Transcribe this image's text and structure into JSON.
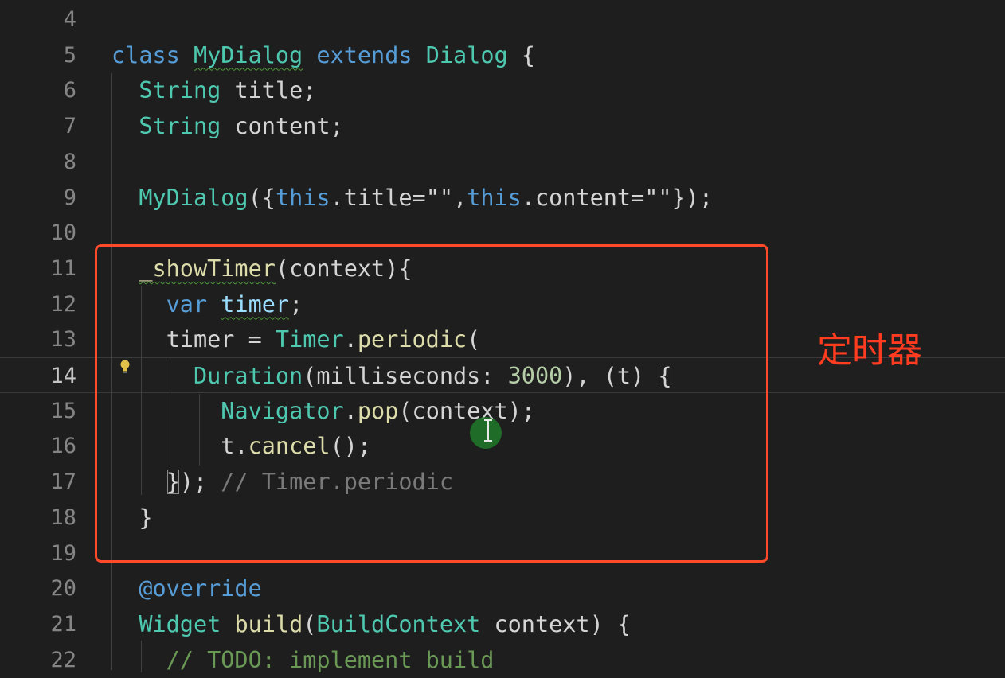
{
  "lines": [
    {
      "num": "4"
    },
    {
      "num": "5",
      "tokens": [
        [
          "class ",
          "kw"
        ],
        [
          "MyDialog",
          "ty squig"
        ],
        [
          " ",
          "p"
        ],
        [
          "extends",
          "kw"
        ],
        [
          " ",
          "p"
        ],
        [
          "Dialog",
          "ty"
        ],
        [
          " {",
          "p"
        ]
      ]
    },
    {
      "num": "6",
      "tokens": [
        [
          "  ",
          "p"
        ],
        [
          "String",
          "ty"
        ],
        [
          " title;",
          "p"
        ]
      ]
    },
    {
      "num": "7",
      "tokens": [
        [
          "  ",
          "p"
        ],
        [
          "String",
          "ty"
        ],
        [
          " content;",
          "p"
        ]
      ]
    },
    {
      "num": "8"
    },
    {
      "num": "9",
      "tokens": [
        [
          "  ",
          "p"
        ],
        [
          "MyDialog",
          "ty"
        ],
        [
          "({",
          "p"
        ],
        [
          "this",
          "kw"
        ],
        [
          ".title=",
          "p"
        ],
        [
          "\"\"",
          "p"
        ],
        [
          ",",
          "p"
        ],
        [
          "this",
          "kw"
        ],
        [
          ".content=",
          "p"
        ],
        [
          "\"\"",
          "p"
        ],
        [
          "});",
          "p"
        ]
      ]
    },
    {
      "num": "10"
    },
    {
      "num": "11",
      "tokens": [
        [
          "  ",
          "p"
        ],
        [
          "_showTimer",
          "fn squig"
        ],
        [
          "(context){",
          "p"
        ]
      ]
    },
    {
      "num": "12",
      "tokens": [
        [
          "    ",
          "p"
        ],
        [
          "var",
          "kw"
        ],
        [
          " ",
          "p"
        ],
        [
          "timer",
          "var squig"
        ],
        [
          ";",
          "p"
        ]
      ]
    },
    {
      "num": "13",
      "tokens": [
        [
          "    timer = ",
          "p"
        ],
        [
          "Timer",
          "ty"
        ],
        [
          ".",
          "p"
        ],
        [
          "periodic",
          "fn"
        ],
        [
          "(",
          "p"
        ]
      ]
    },
    {
      "num": "14",
      "tokens": [
        [
          "      ",
          "p"
        ],
        [
          "Duration",
          "ty"
        ],
        [
          "(milliseconds: ",
          "p"
        ],
        [
          "3000",
          "num"
        ],
        [
          "), (t) ",
          "p"
        ],
        [
          "{",
          "p bracket-box"
        ]
      ]
    },
    {
      "num": "15",
      "tokens": [
        [
          "        ",
          "p"
        ],
        [
          "Navigator",
          "ty"
        ],
        [
          ".",
          "p"
        ],
        [
          "pop",
          "fn"
        ],
        [
          "(context);",
          "p"
        ]
      ]
    },
    {
      "num": "16",
      "tokens": [
        [
          "        t.",
          "p"
        ],
        [
          "cancel",
          "fn"
        ],
        [
          "();",
          "p"
        ]
      ]
    },
    {
      "num": "17",
      "tokens": [
        [
          "    ",
          "p"
        ],
        [
          "}",
          "p bracket-box"
        ],
        [
          "); ",
          "p"
        ],
        [
          "// Timer.periodic",
          "com-dim"
        ]
      ]
    },
    {
      "num": "18",
      "tokens": [
        [
          "  }",
          "p"
        ]
      ]
    },
    {
      "num": "19"
    },
    {
      "num": "20",
      "tokens": [
        [
          "  ",
          "p"
        ],
        [
          "@override",
          "ann"
        ]
      ]
    },
    {
      "num": "21",
      "tokens": [
        [
          "  ",
          "p"
        ],
        [
          "Widget",
          "ty"
        ],
        [
          " ",
          "p"
        ],
        [
          "build",
          "fn"
        ],
        [
          "(",
          "p"
        ],
        [
          "BuildContext",
          "ty"
        ],
        [
          " context) {",
          "p"
        ]
      ]
    },
    {
      "num": "22",
      "tokens": [
        [
          "    ",
          "p"
        ],
        [
          "// TODO: implement build",
          "com"
        ]
      ]
    }
  ],
  "annotation": {
    "label": "定时器",
    "color": "#ff3b20"
  }
}
